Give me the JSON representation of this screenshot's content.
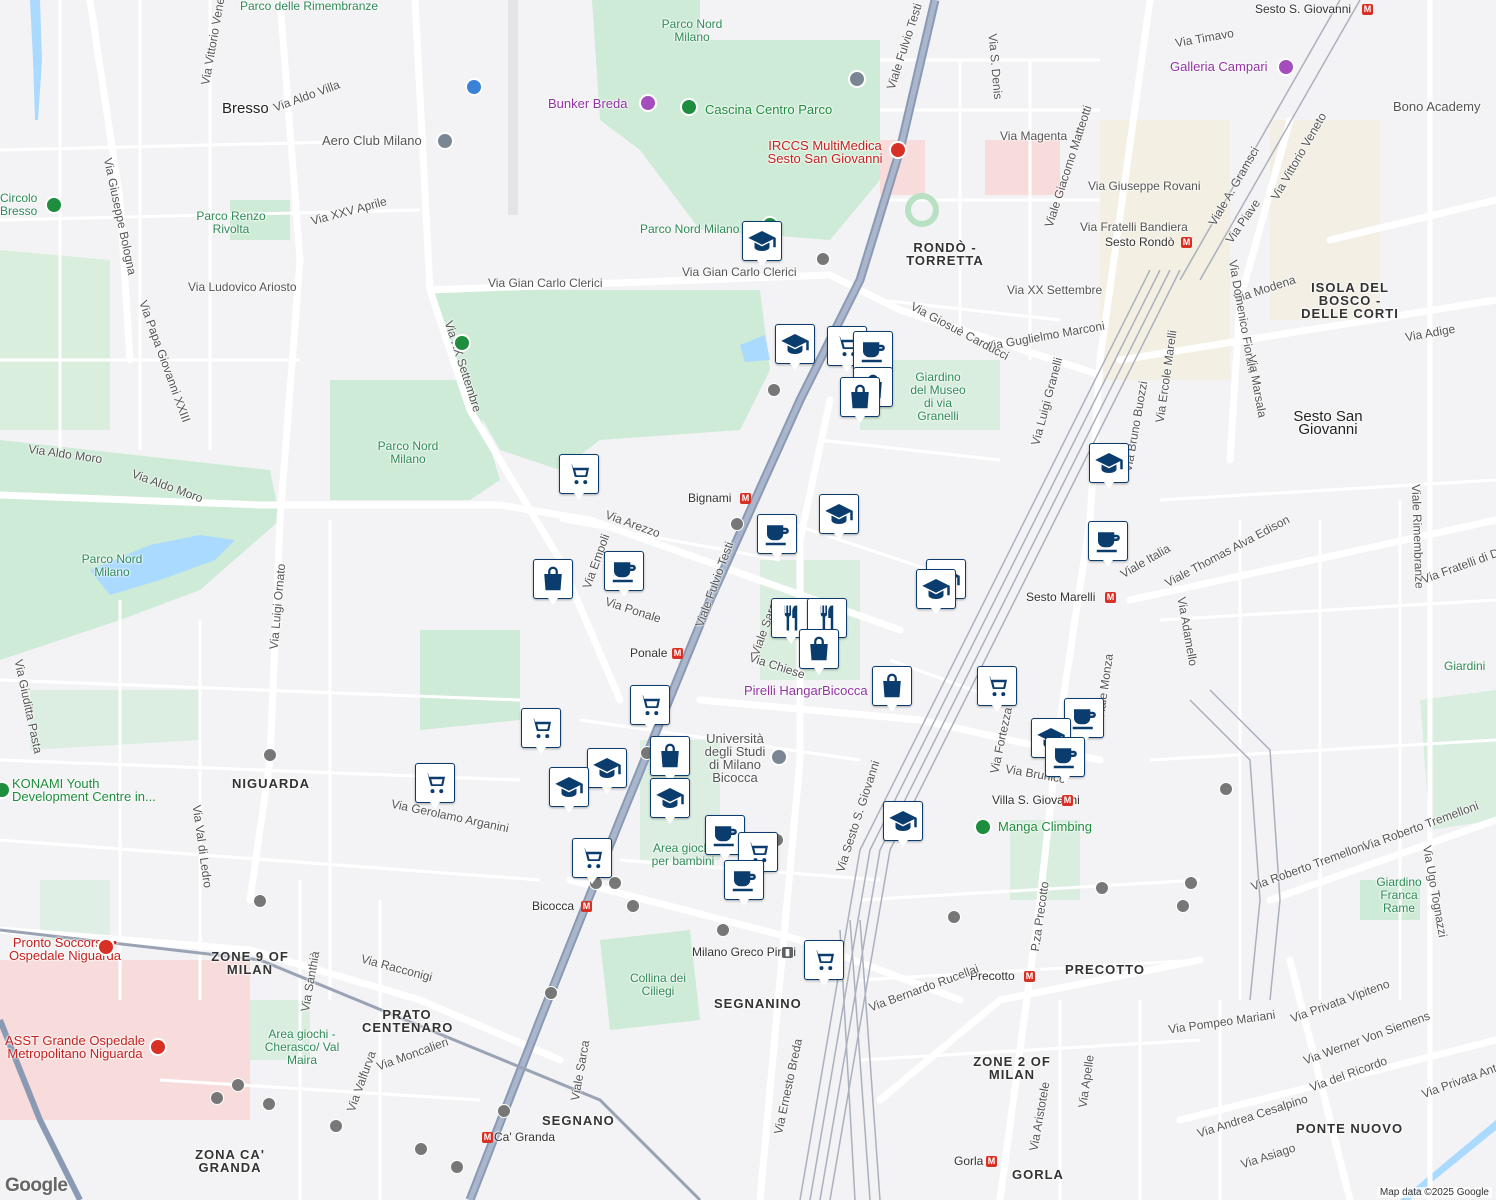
{
  "map": {
    "attribution": "Map data ©2025 Google",
    "logo": "Google",
    "colors": {
      "park": "#cdebd6",
      "water": "#aadaff",
      "road": "#ffffff",
      "rail": "#9aa3b3",
      "highway": "#8a9ab4",
      "hospital": "#f8dcdc",
      "marker": "#0b3c6e"
    },
    "labels": [
      {
        "id": "l1",
        "text": "Parco delle Rimembranze",
        "cls": "park"
      },
      {
        "id": "l2",
        "text": "Parco Nord Milano",
        "cls": "park"
      },
      {
        "id": "l3",
        "text": "Bresso",
        "cls": "town"
      },
      {
        "id": "l4",
        "text": "Via Aldo Villa",
        "cls": ""
      },
      {
        "id": "l5",
        "text": "Aero Club Milano",
        "cls": "poi"
      },
      {
        "id": "l6",
        "text": "Bunker Breda",
        "cls": "poi purple"
      },
      {
        "id": "l7",
        "text": "Cascina Centro Parco",
        "cls": "poi green"
      },
      {
        "id": "l8",
        "text": "IRCCS MultiMedica Sesto San Giovanni",
        "cls": "poi red"
      },
      {
        "id": "l9",
        "text": "Viale Fulvio Testi",
        "cls": ""
      },
      {
        "id": "l10",
        "text": "Sesto S. Giovanni",
        "cls": "metro"
      },
      {
        "id": "l11",
        "text": "Via Timavo",
        "cls": ""
      },
      {
        "id": "l12",
        "text": "Galleria Campari",
        "cls": "poi purple"
      },
      {
        "id": "l13",
        "text": "Bono Academy",
        "cls": "poi"
      },
      {
        "id": "l14",
        "text": "Via Magenta",
        "cls": ""
      },
      {
        "id": "l15",
        "text": "Via Giuseppe Rovani",
        "cls": ""
      },
      {
        "id": "l16",
        "text": "Via Fratelli Bandiera",
        "cls": ""
      },
      {
        "id": "l17",
        "text": "Sesto Rondò",
        "cls": "metro"
      },
      {
        "id": "l18",
        "text": "RONDÒ - TORRETTA",
        "cls": "area"
      },
      {
        "id": "l19",
        "text": "Via XX Settembre",
        "cls": ""
      },
      {
        "id": "l20",
        "text": "ISOLA DEL BOSCO - DELLE CORTI",
        "cls": "area"
      },
      {
        "id": "l21",
        "text": "Via Modena",
        "cls": ""
      },
      {
        "id": "l22",
        "text": "Via Adige",
        "cls": ""
      },
      {
        "id": "l23",
        "text": "Via Guglielmo Marconi",
        "cls": ""
      },
      {
        "id": "l24",
        "text": "Via Giosuè Carducci",
        "cls": ""
      },
      {
        "id": "l25",
        "text": "Giardino del Museo di via Granelli",
        "cls": "park"
      },
      {
        "id": "l26",
        "text": "Sesto San Giovanni",
        "cls": "town"
      },
      {
        "id": "l27",
        "text": "Circolo Bresso",
        "cls": "park"
      },
      {
        "id": "l28",
        "text": "Parco Renzo Rivolta",
        "cls": "park"
      },
      {
        "id": "l29",
        "text": "Via XXV Aprile",
        "cls": ""
      },
      {
        "id": "l30",
        "text": "Via Ludovico Ariosto",
        "cls": ""
      },
      {
        "id": "l31",
        "text": "Via Gian Carlo Clerici",
        "cls": ""
      },
      {
        "id": "l32",
        "text": "Via Gian Carlo Clerici",
        "cls": ""
      },
      {
        "id": "l33",
        "text": "Parco Nord Milano",
        "cls": "park"
      },
      {
        "id": "l34",
        "text": "Via Aldo Moro",
        "cls": ""
      },
      {
        "id": "l35",
        "text": "Via Aldo Moro",
        "cls": ""
      },
      {
        "id": "l36",
        "text": "Parco Nord Milano",
        "cls": "park"
      },
      {
        "id": "l37",
        "text": "Bignami",
        "cls": "metro"
      },
      {
        "id": "l38",
        "text": "Via Arezzo",
        "cls": ""
      },
      {
        "id": "l39",
        "text": "Via Ponale",
        "cls": ""
      },
      {
        "id": "l40",
        "text": "Ponale",
        "cls": "metro"
      },
      {
        "id": "l41",
        "text": "Viale Sarca",
        "cls": ""
      },
      {
        "id": "l42",
        "text": "Via Chiese",
        "cls": ""
      },
      {
        "id": "l43",
        "text": "Pirelli HangarBicocca",
        "cls": "poi purple"
      },
      {
        "id": "l44",
        "text": "Sesto Marelli",
        "cls": "metro"
      },
      {
        "id": "l45",
        "text": "Viale Italia",
        "cls": ""
      },
      {
        "id": "l46",
        "text": "Viale Thomas Alva Edison",
        "cls": ""
      },
      {
        "id": "l47",
        "text": "Parco Nord Milano",
        "cls": "park"
      },
      {
        "id": "l48",
        "text": "Università degli Studi di Milano Bicocca",
        "cls": "poi"
      },
      {
        "id": "l49",
        "text": "NIGUARDA",
        "cls": "area"
      },
      {
        "id": "l50",
        "text": "KONAMI Youth Development Centre in...",
        "cls": "poi green"
      },
      {
        "id": "l51",
        "text": "Via Gerolamo Arganini",
        "cls": ""
      },
      {
        "id": "l52",
        "text": "Area giochi per bambini",
        "cls": "park"
      },
      {
        "id": "l53",
        "text": "Villa S. Giovanni",
        "cls": "metro"
      },
      {
        "id": "l54",
        "text": "Manga Climbing",
        "cls": "poi green"
      },
      {
        "id": "l55",
        "text": "Bicocca",
        "cls": "metro"
      },
      {
        "id": "l56",
        "text": "Via Sesto S. Giovanni",
        "cls": ""
      },
      {
        "id": "l57",
        "text": "Milano Greco Pirelli",
        "cls": "metro"
      },
      {
        "id": "l58",
        "text": "SEGNANINO",
        "cls": "area"
      },
      {
        "id": "l59",
        "text": "Collina dei Ciliegi",
        "cls": "park"
      },
      {
        "id": "l60",
        "text": "Pronto Soccorso • Ospedale Niguarda",
        "cls": "poi red"
      },
      {
        "id": "l61",
        "text": "ZONE 9 OF MILAN",
        "cls": "area"
      },
      {
        "id": "l62",
        "text": "Via Racconigi",
        "cls": ""
      },
      {
        "id": "l63",
        "text": "PRATO CENTENARO",
        "cls": "area"
      },
      {
        "id": "l64",
        "text": "Area giochi - Cherasco/ Val Maira",
        "cls": "park"
      },
      {
        "id": "l65",
        "text": "ASST Grande Ospedale Metropolitano Niguarda",
        "cls": "poi red"
      },
      {
        "id": "l66",
        "text": "Via Moncalieri",
        "cls": ""
      },
      {
        "id": "l67",
        "text": "Precotto",
        "cls": "metro"
      },
      {
        "id": "l68",
        "text": "PRECOTTO",
        "cls": "area"
      },
      {
        "id": "l69",
        "text": "Via Bernardo Rucellai",
        "cls": ""
      },
      {
        "id": "l70",
        "text": "ZONE 2 OF MILAN",
        "cls": "area"
      },
      {
        "id": "l71",
        "text": "Via Pompeo Mariani",
        "cls": ""
      },
      {
        "id": "l72",
        "text": "Via Privata Vipiteno",
        "cls": ""
      },
      {
        "id": "l73",
        "text": "Via Werner Von Siemens",
        "cls": ""
      },
      {
        "id": "l74",
        "text": "Via del Ricordo",
        "cls": ""
      },
      {
        "id": "l75",
        "text": "Via Andrea Cesalpino",
        "cls": ""
      },
      {
        "id": "l76",
        "text": "PONTE NUOVO",
        "cls": "area"
      },
      {
        "id": "l77",
        "text": "Via Asiago",
        "cls": ""
      },
      {
        "id": "l78",
        "text": "Gorla",
        "cls": "metro"
      },
      {
        "id": "l79",
        "text": "GORLA",
        "cls": "area"
      },
      {
        "id": "l80",
        "text": "SEGNANO",
        "cls": "area"
      },
      {
        "id": "l81",
        "text": "Ca' Granda",
        "cls": "metro"
      },
      {
        "id": "l82",
        "text": "ZONA CA' GRANDA",
        "cls": "area"
      },
      {
        "id": "l83",
        "text": "Giardino Franca Rame",
        "cls": "park"
      },
      {
        "id": "l84",
        "text": "Via Roberto Tremelloni",
        "cls": ""
      },
      {
        "id": "l85",
        "text": "Via Roberto Tremelloni",
        "cls": ""
      },
      {
        "id": "l86",
        "text": "Via Ugo Tognazzi",
        "cls": ""
      },
      {
        "id": "l87",
        "text": "Viale Rimembranze",
        "cls": ""
      },
      {
        "id": "l88",
        "text": "Viale Fulvio Testi",
        "cls": ""
      },
      {
        "id": "l89",
        "text": "Via Fortezza",
        "cls": ""
      },
      {
        "id": "l90",
        "text": "Via Brunico",
        "cls": ""
      },
      {
        "id": "l91",
        "text": "Viale Monza",
        "cls": ""
      },
      {
        "id": "l92",
        "text": "P.za Precotto",
        "cls": ""
      },
      {
        "id": "l93",
        "text": "Via Vittorio Veneto",
        "cls": ""
      },
      {
        "id": "l94",
        "text": "Via XX Settembre",
        "cls": ""
      },
      {
        "id": "l95",
        "text": "Via Luigi Ornato",
        "cls": ""
      },
      {
        "id": "l96",
        "text": "Via Papa Giovanni XXIII",
        "cls": ""
      },
      {
        "id": "l97",
        "text": "Via Giuseppe Bologna",
        "cls": ""
      },
      {
        "id": "l98",
        "text": "Via Val di Ledro",
        "cls": ""
      },
      {
        "id": "l99",
        "text": "Via Giuditta Pasta",
        "cls": ""
      },
      {
        "id": "l100",
        "text": "Via Empoli",
        "cls": ""
      },
      {
        "id": "l101",
        "text": "Viale Sarca",
        "cls": ""
      },
      {
        "id": "l102",
        "text": "Via Ernesto Breda",
        "cls": ""
      },
      {
        "id": "l103",
        "text": "Via Aristotele",
        "cls": ""
      },
      {
        "id": "l104",
        "text": "Via Apelle",
        "cls": ""
      },
      {
        "id": "l105",
        "text": "Via S. Denis",
        "cls": ""
      },
      {
        "id": "l106",
        "text": "Viale Giacomo Matteotti",
        "cls": ""
      },
      {
        "id": "l107",
        "text": "Viale A. Gramsci",
        "cls": ""
      },
      {
        "id": "l108",
        "text": "Via Piave",
        "cls": ""
      },
      {
        "id": "l109",
        "text": "Via Vittorio Veneto",
        "cls": ""
      },
      {
        "id": "l110",
        "text": "Via Bruno Buozzi",
        "cls": ""
      },
      {
        "id": "l111",
        "text": "Via Ercole Marelli",
        "cls": ""
      },
      {
        "id": "l112",
        "text": "Via Domenico Fiorani",
        "cls": ""
      },
      {
        "id": "l113",
        "text": "Via Marsala",
        "cls": ""
      },
      {
        "id": "l114",
        "text": "Via Luigi Granelli",
        "cls": ""
      },
      {
        "id": "l115",
        "text": "Via Santhià",
        "cls": ""
      },
      {
        "id": "l116",
        "text": "Via Valfurva",
        "cls": ""
      },
      {
        "id": "l117",
        "text": "Via Adamello",
        "cls": ""
      },
      {
        "id": "l118",
        "text": "Giardini",
        "cls": "park"
      },
      {
        "id": "l119",
        "text": "Via Fratelli di D",
        "cls": ""
      },
      {
        "id": "l120",
        "text": "Via Privata Ant",
        "cls": ""
      }
    ],
    "markers": [
      {
        "id": "m1",
        "icon": "school"
      },
      {
        "id": "m2",
        "icon": "school"
      },
      {
        "id": "m3",
        "icon": "cart"
      },
      {
        "id": "m4",
        "icon": "cup"
      },
      {
        "id": "m5",
        "icon": "bag"
      },
      {
        "id": "m6",
        "icon": "cart"
      },
      {
        "id": "m7",
        "icon": "cup"
      },
      {
        "id": "m8",
        "icon": "bag"
      },
      {
        "id": "m9",
        "icon": "cup"
      },
      {
        "id": "m10",
        "icon": "school"
      },
      {
        "id": "m11",
        "icon": "school"
      },
      {
        "id": "m12",
        "icon": "fork"
      },
      {
        "id": "m13",
        "icon": "fork"
      },
      {
        "id": "m14",
        "icon": "bag"
      },
      {
        "id": "m15",
        "icon": "bag"
      },
      {
        "id": "m16",
        "icon": "school"
      },
      {
        "id": "m17",
        "icon": "cup"
      },
      {
        "id": "m18",
        "icon": "cart"
      },
      {
        "id": "m19",
        "icon": "cup"
      },
      {
        "id": "m20",
        "icon": "cup"
      },
      {
        "id": "m21",
        "icon": "cart"
      },
      {
        "id": "m22",
        "icon": "cart"
      },
      {
        "id": "m23",
        "icon": "school"
      },
      {
        "id": "m24",
        "icon": "bag"
      },
      {
        "id": "m25",
        "icon": "school"
      },
      {
        "id": "m26",
        "icon": "cart"
      },
      {
        "id": "m27",
        "icon": "school"
      },
      {
        "id": "m28",
        "icon": "cart"
      },
      {
        "id": "m29",
        "icon": "cup"
      },
      {
        "id": "m30",
        "icon": "cart"
      },
      {
        "id": "m31",
        "icon": "cup"
      },
      {
        "id": "m32",
        "icon": "school"
      },
      {
        "id": "m33",
        "icon": "cart"
      }
    ]
  }
}
